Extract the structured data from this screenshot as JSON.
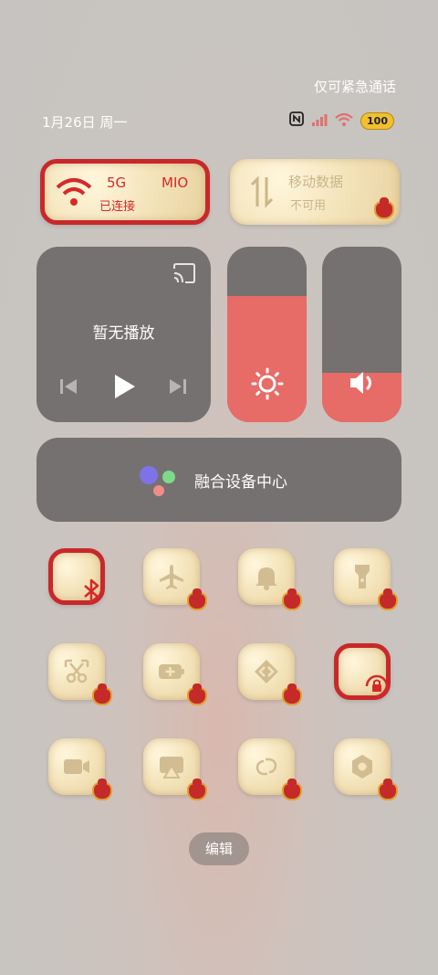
{
  "status_bar": {
    "carrier": "仅可紧急通话",
    "date": "1月26日 周一",
    "battery": "100"
  },
  "wifi": {
    "label_5g": "5G",
    "label_mio": "MIO",
    "status": "已连接"
  },
  "mobile_data": {
    "label": "移动数据",
    "status": "不可用"
  },
  "media": {
    "title": "暂无播放"
  },
  "brightness": {
    "level": 0.72
  },
  "volume": {
    "level": 0.28
  },
  "fusion": {
    "label": "融合设备中心"
  },
  "toggles": [
    "bluetooth-icon",
    "airplane-icon",
    "bell-icon",
    "flashlight-icon",
    "screenshot-icon",
    "battery-saver-icon",
    "link-icon",
    "rotation-lock-icon",
    "screen-record-icon",
    "screencast-icon",
    "hotspot-icon",
    "settings-icon"
  ],
  "edit_label": "编辑",
  "colors": {
    "accent": "#e76b67",
    "panel": "#757170",
    "frame_red": "#c8282a"
  }
}
